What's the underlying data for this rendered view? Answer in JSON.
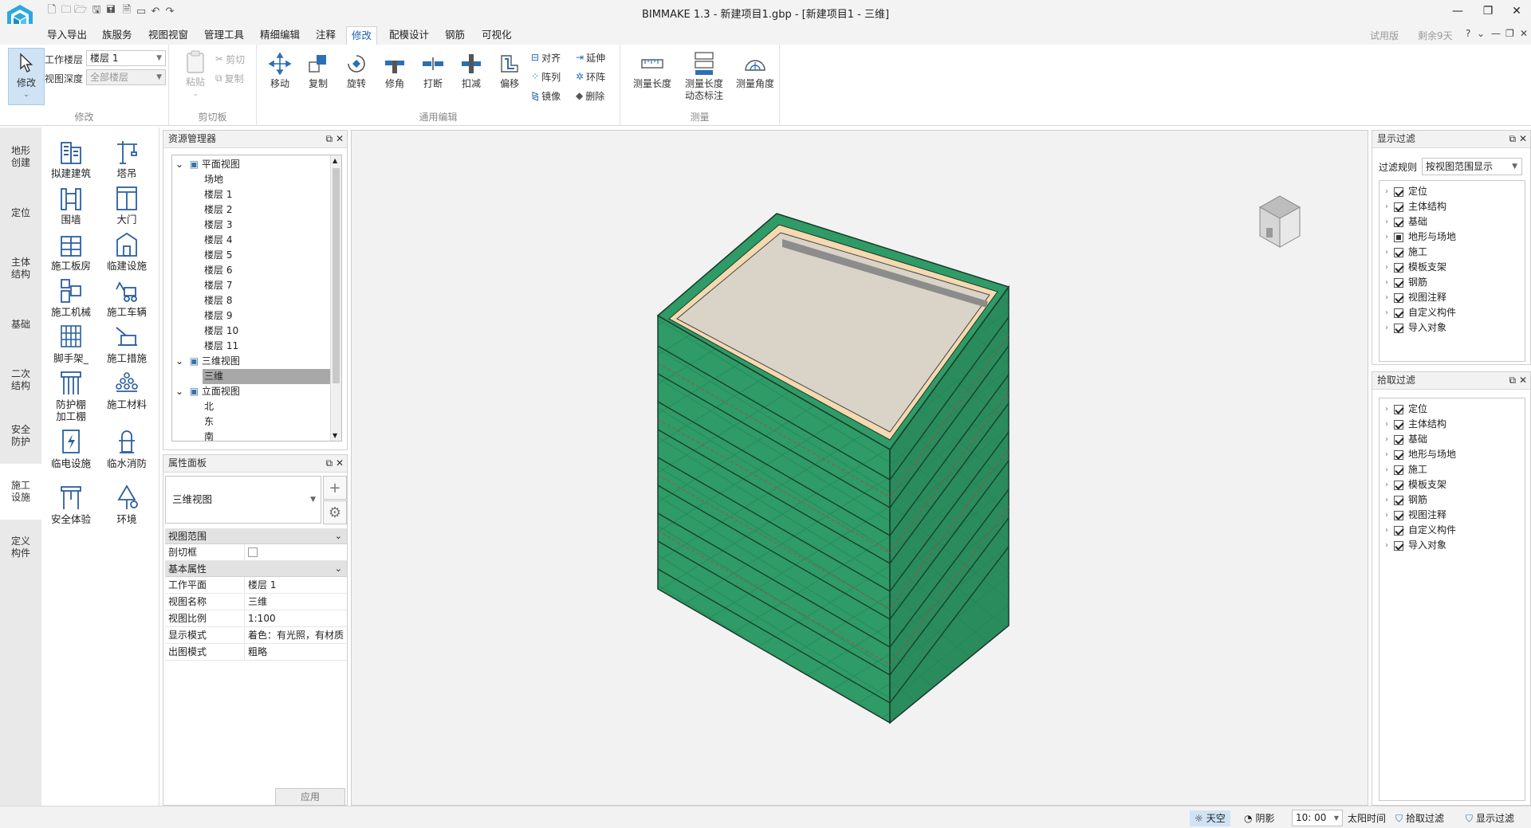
{
  "window": {
    "title": "BIMMAKE 1.3 - 新建项目1.gbp - [新建项目1 - 三维]",
    "trial": "试用版",
    "days_left": "剩余9天",
    "help": "?"
  },
  "menu": {
    "tabs": [
      "导入导出",
      "族服务",
      "视图视窗",
      "管理工具",
      "精细编辑",
      "注释",
      "修改",
      "配模设计",
      "钢筋",
      "可视化"
    ],
    "active": "修改"
  },
  "ribbon": {
    "modify_group": {
      "button": "修改",
      "work_floor_label": "工作楼层",
      "work_floor_value": "楼层 1",
      "view_depth_label": "视图深度",
      "view_depth_value": "全部楼层",
      "label": "修改"
    },
    "clipboard": {
      "paste": "粘贴",
      "cut": "剪切",
      "copy": "复制",
      "label": "剪切板"
    },
    "edit": {
      "move": "移动",
      "copy": "复制",
      "rotate": "旋转",
      "trim": "修角",
      "break": "打断",
      "deduct": "扣减",
      "offset": "偏移",
      "align": "对齐",
      "array": "阵列",
      "mirror": "镜像",
      "extend": "延伸",
      "ring_array": "环阵",
      "delete": "删除",
      "label": "通用编辑"
    },
    "measure": {
      "length": "测量长度",
      "dynamic_line1": "测量长度",
      "dynamic_line2": "动态标注",
      "angle": "测量角度",
      "label": "测量"
    }
  },
  "left_tabs": [
    [
      "地形",
      "创建"
    ],
    [
      "定位"
    ],
    [
      "主体",
      "结构"
    ],
    [
      "基础"
    ],
    [
      "二次",
      "结构"
    ],
    [
      "安全",
      "防护"
    ],
    [
      "施工",
      "设施"
    ],
    [
      "定义",
      "构件"
    ]
  ],
  "left_tabs_active": 6,
  "palette": [
    [
      "拟建建筑"
    ],
    [
      "塔吊"
    ],
    [
      "围墙"
    ],
    [
      "大门"
    ],
    [
      "施工板房"
    ],
    [
      "临建设施"
    ],
    [
      "施工机械"
    ],
    [
      "施工车辆"
    ],
    [
      "脚手架_"
    ],
    [
      "施工措施"
    ],
    [
      "防护棚",
      "加工棚"
    ],
    [
      "施工材料"
    ],
    [
      "临电设施"
    ],
    [
      "临水消防"
    ],
    [
      "安全体验"
    ],
    [
      "环境"
    ]
  ],
  "resource_manager": {
    "title": "资源管理器",
    "plan_views": "平面视图",
    "plan_items": [
      "场地",
      "楼层 1",
      "楼层 2",
      "楼层 3",
      "楼层 4",
      "楼层 5",
      "楼层 6",
      "楼层 7",
      "楼层 8",
      "楼层 9",
      "楼层 10",
      "楼层 11"
    ],
    "views_3d": "三维视图",
    "view_3d_item": "三维",
    "elevation_views": "立面视图",
    "elevation_items": [
      "北",
      "东",
      "南"
    ]
  },
  "properties": {
    "title": "属性面板",
    "type": "三维视图",
    "sections": {
      "view_range": "视图范围",
      "basic": "基本属性"
    },
    "crop_box": "剖切框",
    "rows": [
      {
        "k": "工作平面",
        "v": "楼层 1"
      },
      {
        "k": "视图名称",
        "v": "三维"
      },
      {
        "k": "视图比例",
        "v": "1:100"
      },
      {
        "k": "显示模式",
        "v": "着色：有光照，有材质"
      },
      {
        "k": "出图模式",
        "v": "粗略"
      }
    ],
    "apply": "应用"
  },
  "display_filter": {
    "title": "显示过滤",
    "rule_label": "过滤规则",
    "rule_value": "按视图范围显示",
    "items": [
      {
        "label": "定位",
        "state": "checked"
      },
      {
        "label": "主体结构",
        "state": "checked"
      },
      {
        "label": "基础",
        "state": "checked"
      },
      {
        "label": "地形与场地",
        "state": "partial"
      },
      {
        "label": "施工",
        "state": "checked"
      },
      {
        "label": "模板支架",
        "state": "checked"
      },
      {
        "label": "钢筋",
        "state": "checked"
      },
      {
        "label": "视图注释",
        "state": "checked"
      },
      {
        "label": "自定义构件",
        "state": "checked"
      },
      {
        "label": "导入对象",
        "state": "checked"
      }
    ]
  },
  "pick_filter": {
    "title": "拾取过滤",
    "items": [
      {
        "label": "定位",
        "state": "checked"
      },
      {
        "label": "主体结构",
        "state": "checked"
      },
      {
        "label": "基础",
        "state": "checked"
      },
      {
        "label": "地形与场地",
        "state": "checked"
      },
      {
        "label": "施工",
        "state": "checked"
      },
      {
        "label": "模板支架",
        "state": "checked"
      },
      {
        "label": "钢筋",
        "state": "checked"
      },
      {
        "label": "视图注释",
        "state": "checked"
      },
      {
        "label": "自定义构件",
        "state": "checked"
      },
      {
        "label": "导入对象",
        "state": "checked"
      }
    ]
  },
  "statusbar": {
    "sky": "天空",
    "shadow": "阴影",
    "time": "10: 00",
    "sun_time": "太阳时间",
    "pick_filter": "拾取过滤",
    "display_filter": "显示过滤"
  },
  "colors": {
    "accent": "#1a5fb4",
    "building_green": "#2e9e68",
    "selection": "#cfe3f5"
  }
}
